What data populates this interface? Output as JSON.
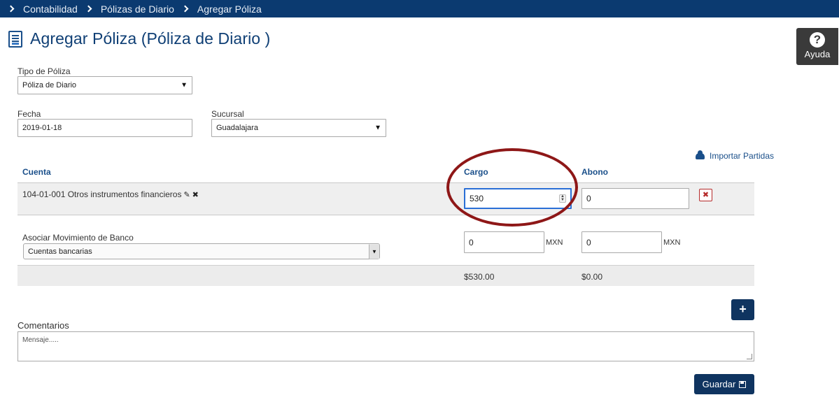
{
  "breadcrumb": [
    "Contabilidad",
    "Pólizas de Diario",
    "Agregar Póliza"
  ],
  "title": "Agregar Póliza (Póliza de Diario )",
  "help": {
    "icon": "question-circle-icon",
    "label": "Ayuda",
    "symbol": "?"
  },
  "form": {
    "tipo_label": "Tipo de Póliza",
    "tipo_value": "Póliza de Diario",
    "fecha_label": "Fecha",
    "fecha_value": "2019-01-18",
    "sucursal_label": "Sucursal",
    "sucursal_value": "Guadalajara",
    "caret": "▼"
  },
  "import_label": "Importar Partidas",
  "table": {
    "headers": {
      "cuenta": "Cuenta",
      "cargo": "Cargo",
      "abono": "Abono"
    },
    "row": {
      "cuenta": "104-01-001 Otros instrumentos financieros",
      "edit_icon": "✎",
      "remove_icon": "✖",
      "cargo": "530",
      "abono": "0",
      "delete_symbol": "✖"
    },
    "bank": {
      "label": "Asociar Movimiento de Banco",
      "select_value": "Cuentas bancarias",
      "cargo": "0",
      "abono": "0",
      "currency": "MXN"
    },
    "totals": {
      "cargo": "$530.00",
      "abono": "$0.00"
    }
  },
  "add_symbol": "+",
  "comentarios_label": "Comentarios",
  "comentarios_placeholder": "Mensaje.....",
  "save_label": "Guardar",
  "colors": {
    "nav": "#0b3a70",
    "accent": "#1a4f8a",
    "button": "#0f3460",
    "highlight": "#8e1717"
  }
}
